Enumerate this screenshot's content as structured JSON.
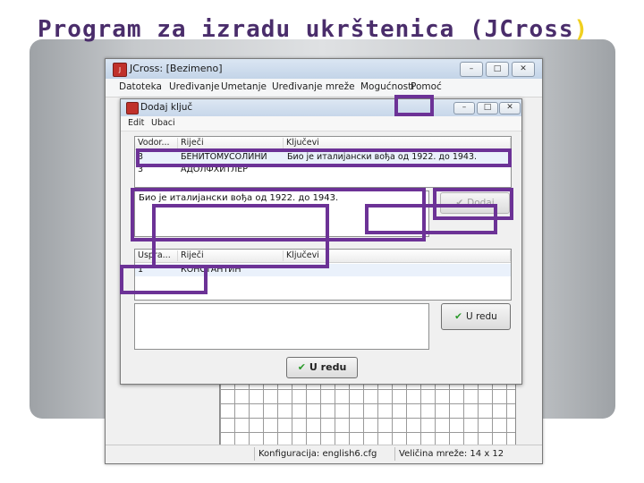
{
  "slide": {
    "title": "Program za izradu ukrštenica (JCross",
    "title_close_paren": ")"
  },
  "window": {
    "title": "JCross: [Bezimeno]",
    "controls": [
      "–",
      "□",
      "✕"
    ],
    "menu": [
      "Datoteka",
      "Uređivanje",
      "Umetanje",
      "Uređivanje mreže",
      "Mogućnosti",
      "Pomoć"
    ],
    "status": {
      "configuration": "Konfiguracija: english6.cfg",
      "grid_size": "Veličina mreže: 14 x 12"
    }
  },
  "dialog": {
    "title": "Dodaj ključ",
    "menu": [
      "Edit",
      "Ubaci"
    ],
    "controls": [
      "–",
      "□",
      "✕"
    ],
    "top_list": {
      "headers": [
        "Vodor...",
        "Riječi",
        "Ključevi"
      ],
      "rows": [
        [
          "3",
          "БЕНИТОМУСОЛИНИ",
          "Био је италијански вођа од 1922. до 1943."
        ],
        [
          "3",
          "АДОЛФХИТЛЕР",
          ""
        ]
      ]
    },
    "clue_text": "Био је италијански вођа од 1922. до 1943.",
    "apply_button": "Dodaj",
    "bottom_list": {
      "headers": [
        "Uspra...",
        "Riječi",
        "Ključevi"
      ],
      "rows": [
        [
          "1",
          "КОНСТАНТИН",
          ""
        ]
      ]
    },
    "ok_small_button": "U redu",
    "ok_button": "U redu"
  },
  "colors": {
    "highlight": "#6c3296",
    "title_text": "#4a2d6b",
    "title_paren": "#f0d020",
    "check_green": "#2a9a2a"
  }
}
